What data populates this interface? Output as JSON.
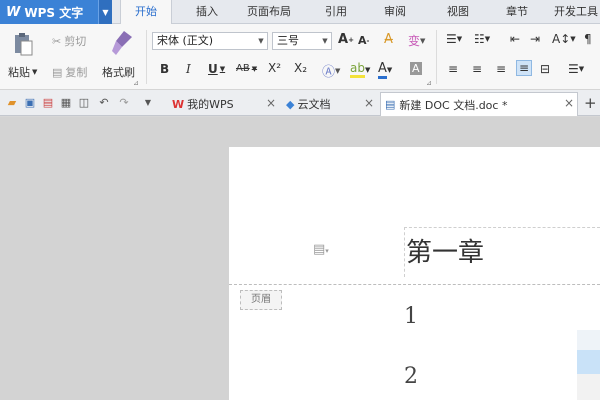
{
  "app": {
    "name": "WPS 文字"
  },
  "ribbon_tabs": [
    {
      "label": "开始"
    },
    {
      "label": "插入"
    },
    {
      "label": "页面布局"
    },
    {
      "label": "引用"
    },
    {
      "label": "审阅"
    },
    {
      "label": "视图"
    },
    {
      "label": "章节"
    },
    {
      "label": "开发工具"
    }
  ],
  "clipboard": {
    "paste": "粘贴",
    "cut": "剪切",
    "copy": "复制",
    "format_painter": "格式刷"
  },
  "font": {
    "name": "宋体 (正文)",
    "size": "三号"
  },
  "format_glyphs": {
    "grow": "A",
    "shrink": "A",
    "bold": "B",
    "italic": "I",
    "underline": "U",
    "strike": "AB",
    "superscript": "X²",
    "subscript": "X₂"
  },
  "quick_tabs": [
    {
      "label": "我的WPS"
    },
    {
      "label": "云文档"
    },
    {
      "label": "新建 DOC 文档.doc *"
    }
  ],
  "document": {
    "header_tag": "页眉",
    "title": "第一章",
    "lines": [
      "1",
      "2"
    ]
  },
  "colors": {
    "accent": "#3b82d6",
    "active_tab_text": "#2b6fce"
  }
}
